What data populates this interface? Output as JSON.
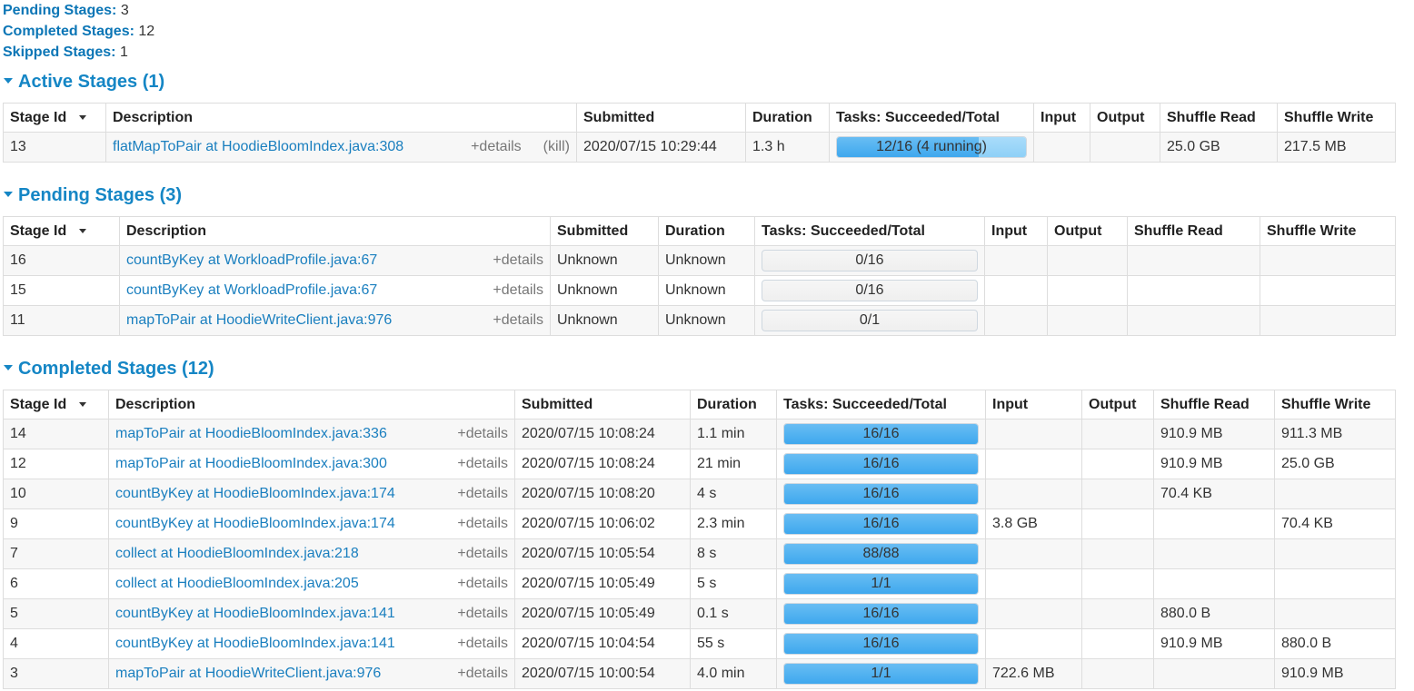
{
  "summary": {
    "pending_label": "Pending Stages:",
    "pending_value": "3",
    "completed_label": "Completed Stages:",
    "completed_value": "12",
    "skipped_label": "Skipped Stages:",
    "skipped_value": "1"
  },
  "columns": {
    "stage_id": "Stage Id",
    "description": "Description",
    "submitted": "Submitted",
    "duration": "Duration",
    "tasks": "Tasks: Succeeded/Total",
    "input": "Input",
    "output": "Output",
    "shuffle_read": "Shuffle Read",
    "shuffle_write": "Shuffle Write"
  },
  "details_label": "+details",
  "kill_label": "(kill)",
  "active": {
    "title": "Active Stages (1)",
    "rows": [
      {
        "id": "13",
        "desc": "flatMapToPair at HoodieBloomIndex.java:308",
        "submitted": "2020/07/15 10:29:44",
        "duration": "1.3 h",
        "tasks": "12/16 (4 running)",
        "done": 12,
        "running": 4,
        "total": 16,
        "input": "",
        "output": "",
        "sread": "25.0 GB",
        "swrite": "217.5 MB"
      }
    ]
  },
  "pending": {
    "title": "Pending Stages (3)",
    "rows": [
      {
        "id": "16",
        "desc": "countByKey at WorkloadProfile.java:67",
        "submitted": "Unknown",
        "duration": "Unknown",
        "tasks": "0/16",
        "done": 0,
        "total": 16,
        "input": "",
        "output": "",
        "sread": "",
        "swrite": ""
      },
      {
        "id": "15",
        "desc": "countByKey at WorkloadProfile.java:67",
        "submitted": "Unknown",
        "duration": "Unknown",
        "tasks": "0/16",
        "done": 0,
        "total": 16,
        "input": "",
        "output": "",
        "sread": "",
        "swrite": ""
      },
      {
        "id": "11",
        "desc": "mapToPair at HoodieWriteClient.java:976",
        "submitted": "Unknown",
        "duration": "Unknown",
        "tasks": "0/1",
        "done": 0,
        "total": 1,
        "input": "",
        "output": "",
        "sread": "",
        "swrite": ""
      }
    ]
  },
  "completed": {
    "title": "Completed Stages (12)",
    "rows": [
      {
        "id": "14",
        "desc": "mapToPair at HoodieBloomIndex.java:336",
        "submitted": "2020/07/15 10:08:24",
        "duration": "1.1 min",
        "tasks": "16/16",
        "done": 16,
        "total": 16,
        "input": "",
        "output": "",
        "sread": "910.9 MB",
        "swrite": "911.3 MB"
      },
      {
        "id": "12",
        "desc": "mapToPair at HoodieBloomIndex.java:300",
        "submitted": "2020/07/15 10:08:24",
        "duration": "21 min",
        "tasks": "16/16",
        "done": 16,
        "total": 16,
        "input": "",
        "output": "",
        "sread": "910.9 MB",
        "swrite": "25.0 GB"
      },
      {
        "id": "10",
        "desc": "countByKey at HoodieBloomIndex.java:174",
        "submitted": "2020/07/15 10:08:20",
        "duration": "4 s",
        "tasks": "16/16",
        "done": 16,
        "total": 16,
        "input": "",
        "output": "",
        "sread": "70.4 KB",
        "swrite": ""
      },
      {
        "id": "9",
        "desc": "countByKey at HoodieBloomIndex.java:174",
        "submitted": "2020/07/15 10:06:02",
        "duration": "2.3 min",
        "tasks": "16/16",
        "done": 16,
        "total": 16,
        "input": "3.8 GB",
        "output": "",
        "sread": "",
        "swrite": "70.4 KB"
      },
      {
        "id": "7",
        "desc": "collect at HoodieBloomIndex.java:218",
        "submitted": "2020/07/15 10:05:54",
        "duration": "8 s",
        "tasks": "88/88",
        "done": 88,
        "total": 88,
        "input": "",
        "output": "",
        "sread": "",
        "swrite": ""
      },
      {
        "id": "6",
        "desc": "collect at HoodieBloomIndex.java:205",
        "submitted": "2020/07/15 10:05:49",
        "duration": "5 s",
        "tasks": "1/1",
        "done": 1,
        "total": 1,
        "input": "",
        "output": "",
        "sread": "",
        "swrite": ""
      },
      {
        "id": "5",
        "desc": "countByKey at HoodieBloomIndex.java:141",
        "submitted": "2020/07/15 10:05:49",
        "duration": "0.1 s",
        "tasks": "16/16",
        "done": 16,
        "total": 16,
        "input": "",
        "output": "",
        "sread": "880.0 B",
        "swrite": ""
      },
      {
        "id": "4",
        "desc": "countByKey at HoodieBloomIndex.java:141",
        "submitted": "2020/07/15 10:04:54",
        "duration": "55 s",
        "tasks": "16/16",
        "done": 16,
        "total": 16,
        "input": "",
        "output": "",
        "sread": "910.9 MB",
        "swrite": "880.0 B"
      },
      {
        "id": "3",
        "desc": "mapToPair at HoodieWriteClient.java:976",
        "submitted": "2020/07/15 10:00:54",
        "duration": "4.0 min",
        "tasks": "1/1",
        "done": 1,
        "total": 1,
        "input": "722.6 MB",
        "output": "",
        "sread": "",
        "swrite": "910.9 MB"
      }
    ]
  }
}
